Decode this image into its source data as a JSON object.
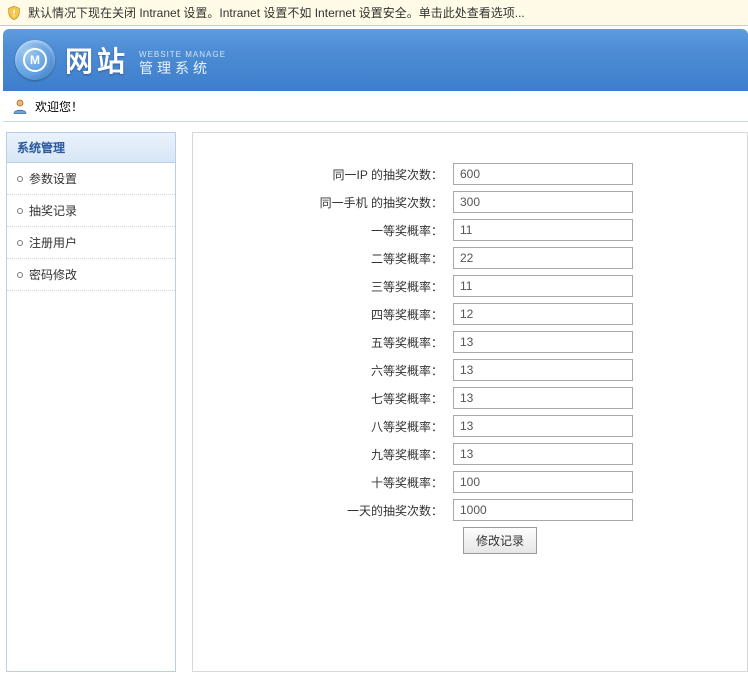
{
  "infobar": {
    "text": "默认情况下现在关闭 Intranet 设置。Intranet 设置不如 Internet 设置安全。单击此处查看选项..."
  },
  "header": {
    "title": "网站",
    "subtitle_en": "WEBSITE MANAGE",
    "subtitle_cn": "管理系统"
  },
  "welcome": {
    "text": "欢迎您！"
  },
  "sidebar": {
    "header": "系统管理",
    "items": [
      {
        "label": "参数设置"
      },
      {
        "label": "抽奖记录"
      },
      {
        "label": "注册用户"
      },
      {
        "label": "密码修改"
      }
    ]
  },
  "form": {
    "rows": [
      {
        "label": "同一IP 的抽奖次数：",
        "value": "600"
      },
      {
        "label": "同一手机 的抽奖次数：",
        "value": "300"
      },
      {
        "label": "一等奖概率：",
        "value": "11"
      },
      {
        "label": "二等奖概率：",
        "value": "22"
      },
      {
        "label": "三等奖概率：",
        "value": "11"
      },
      {
        "label": "四等奖概率：",
        "value": "12"
      },
      {
        "label": "五等奖概率：",
        "value": "13"
      },
      {
        "label": "六等奖概率：",
        "value": "13"
      },
      {
        "label": "七等奖概率：",
        "value": "13"
      },
      {
        "label": "八等奖概率：",
        "value": "13"
      },
      {
        "label": "九等奖概率：",
        "value": "13"
      },
      {
        "label": "十等奖概率：",
        "value": "100"
      },
      {
        "label": "一天的抽奖次数：",
        "value": "1000"
      }
    ],
    "submit_label": "修改记录"
  }
}
